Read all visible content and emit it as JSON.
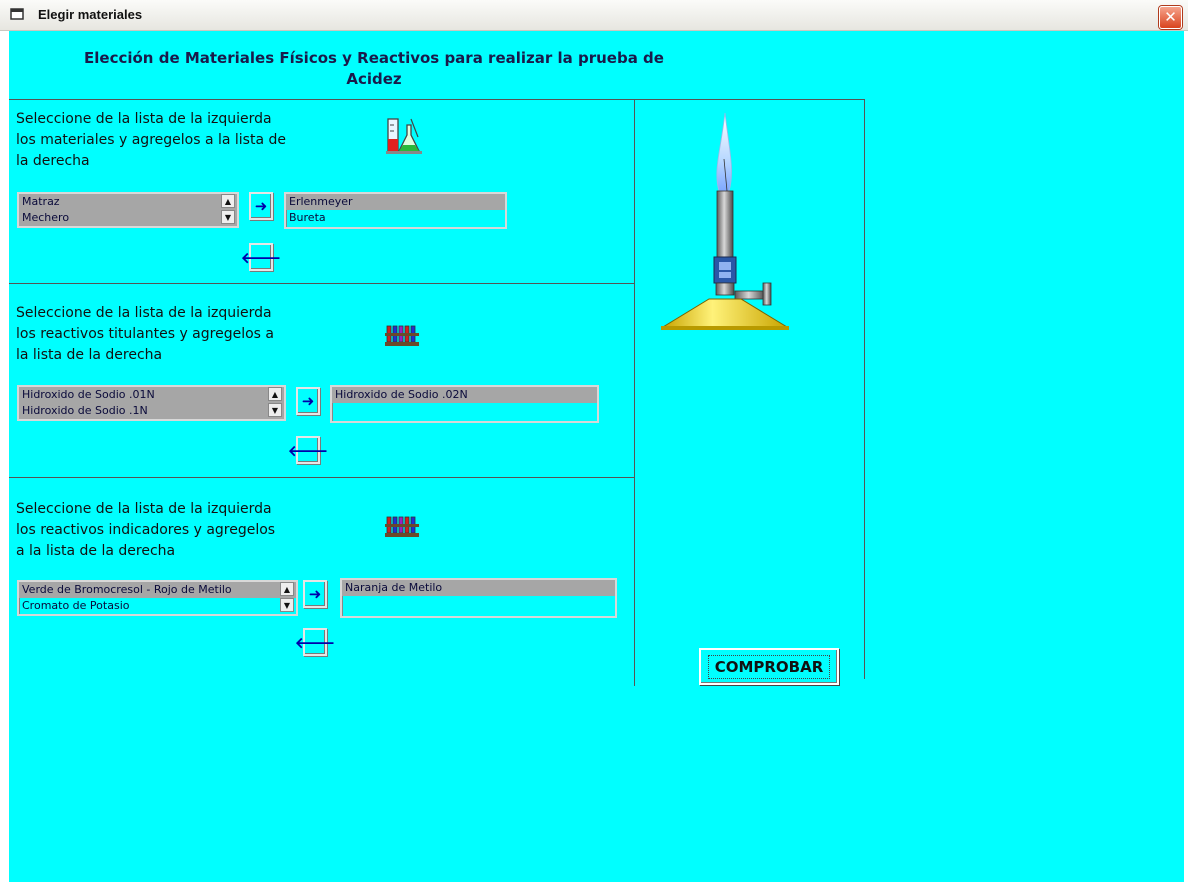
{
  "window": {
    "title": "Elegir materiales",
    "close_symbol": "✕"
  },
  "heading": {
    "line1": "Elección de Materiales Físicos y Reactivos para realizar la prueba de",
    "line2": "Acidez"
  },
  "sections": [
    {
      "instruction": [
        "Seleccione de la lista de la izquierda",
        "los materiales y agregelos a la lista de",
        "la derecha"
      ],
      "icon": "lab-glassware-icon",
      "available": [
        "Matraz",
        "Mechero"
      ],
      "selected": [
        "Erlenmeyer",
        "Bureta"
      ]
    },
    {
      "instruction": [
        "Seleccione de la lista de la izquierda",
        "los reactivos titulantes y agregelos a",
        "la lista de la derecha"
      ],
      "icon": "test-tube-rack-icon",
      "available": [
        "Hidroxido de Sodio .01N",
        "Hidroxido de Sodio .1N"
      ],
      "selected": [
        "Hidroxido de Sodio .02N"
      ]
    },
    {
      "instruction": [
        "Seleccione de la lista de la izquierda",
        "los reactivos indicadores y agregelos",
        "a la lista de la derecha"
      ],
      "icon": "test-tube-rack-icon",
      "available": [
        "Verde de Bromocresol - Rojo de Metilo",
        "Cromato de Potasio"
      ],
      "selected": [
        "Naranja de Metilo"
      ]
    }
  ],
  "buttons": {
    "add_symbol": "➜",
    "remove_symbol": "🡐",
    "check_label": "COMPROBAR"
  },
  "illustration": "bunsen-burner-icon",
  "colors": {
    "background": "#00ffff",
    "selected_row": "#a6a6a6",
    "arrow": "#0000aa"
  }
}
